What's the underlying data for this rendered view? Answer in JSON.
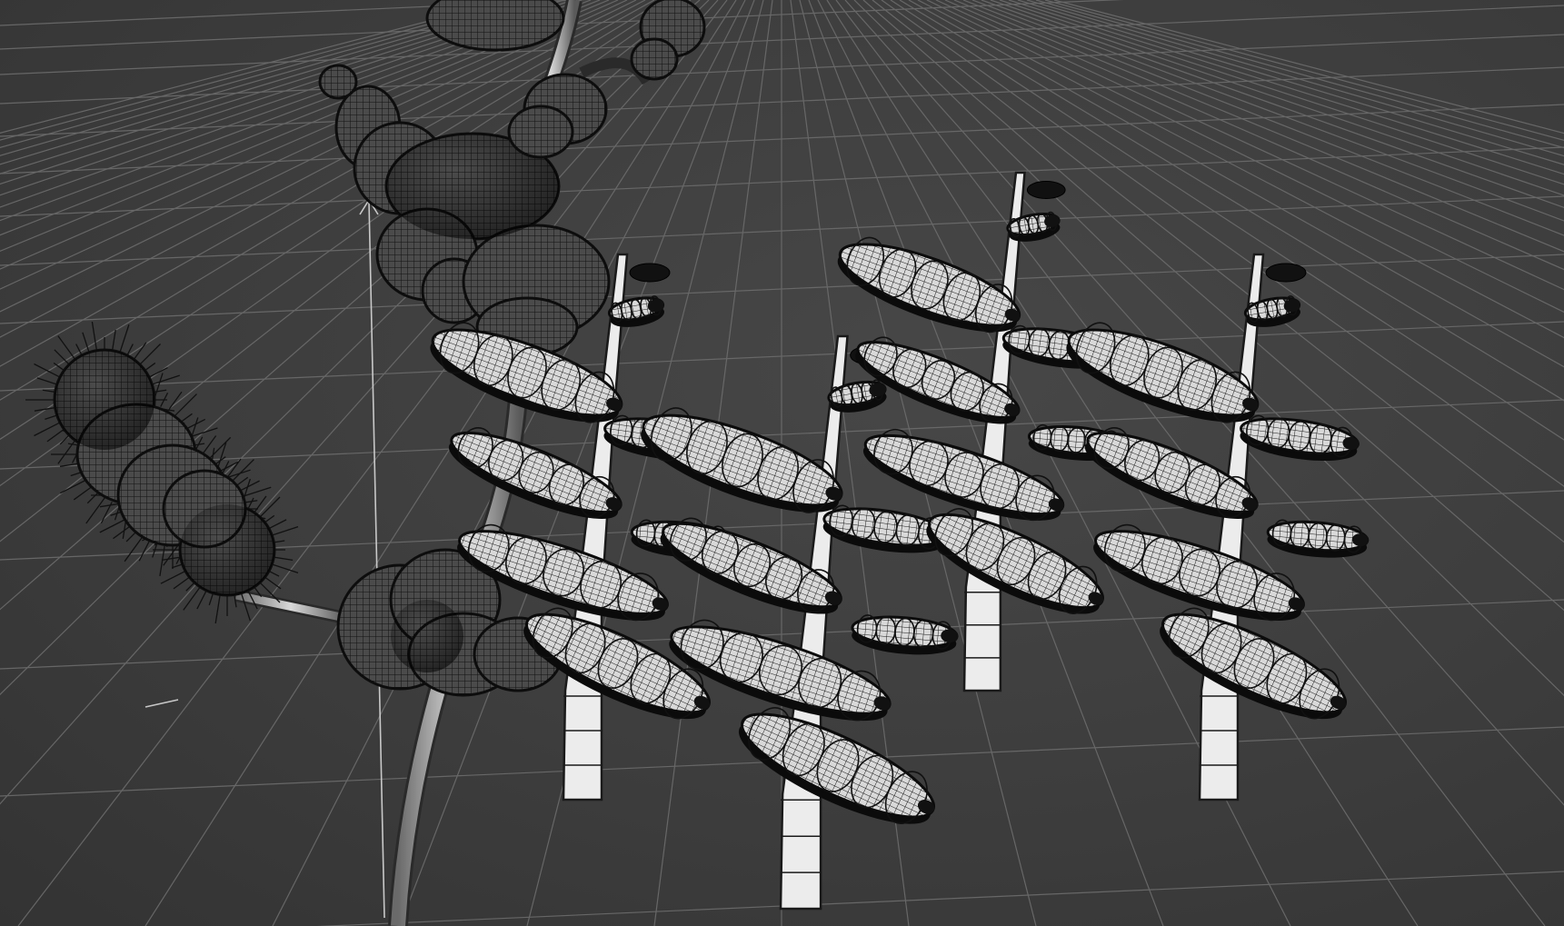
{
  "viewport": {
    "kind": "3d-viewport-wireframe-on-shaded",
    "background_color": "#3e3e3e",
    "grid_color": "#6f6f6f",
    "axis_color": "#bdbdbd",
    "wire_color": "#111111",
    "surface_dark": "#4a4a4a",
    "surface_light": "#e6e6e6"
  },
  "scene_objects": [
    {
      "name": "branching-plant-stem-with-blobs",
      "style": "dark shaded wireframe, hairy pods"
    },
    {
      "name": "segmented-plant-model-1",
      "style": "light shaded wireframe"
    },
    {
      "name": "segmented-plant-model-2",
      "style": "light shaded wireframe"
    },
    {
      "name": "segmented-plant-model-3",
      "style": "light shaded wireframe"
    },
    {
      "name": "segmented-plant-model-4",
      "style": "light shaded wireframe"
    }
  ]
}
